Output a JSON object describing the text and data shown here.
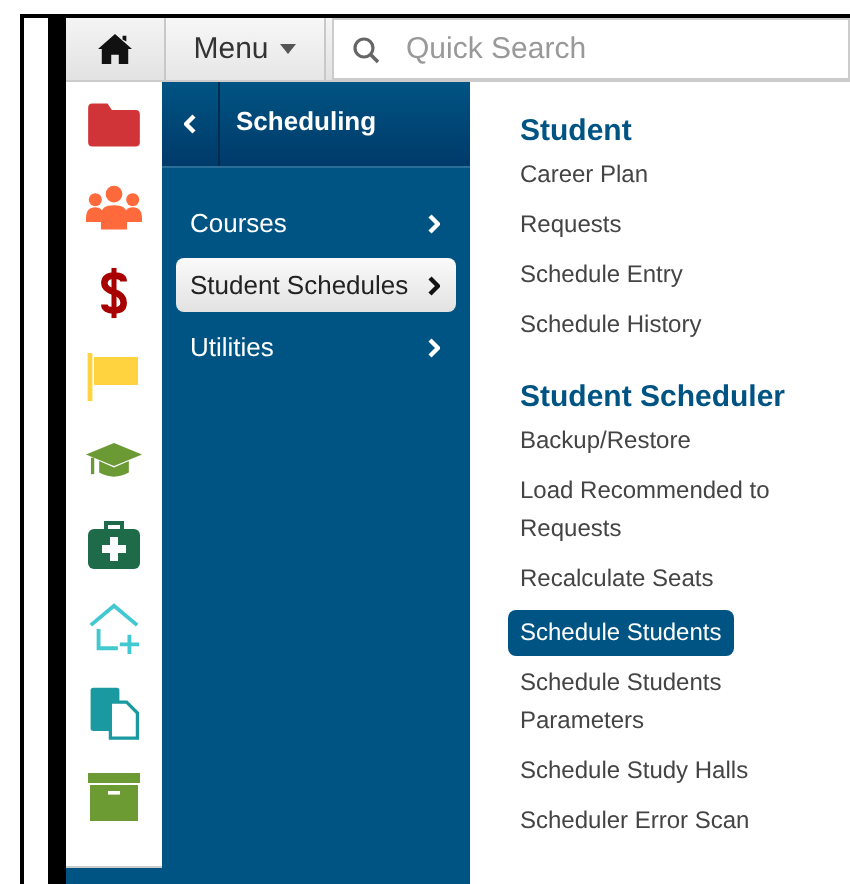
{
  "toolbar": {
    "menu_label": "Menu",
    "search": {
      "placeholder": "Quick Search"
    }
  },
  "submenu": {
    "title": "Scheduling",
    "items": [
      {
        "label": "Courses",
        "selected": false
      },
      {
        "label": "Student Schedules",
        "selected": true
      },
      {
        "label": "Utilities",
        "selected": false
      }
    ]
  },
  "sections": [
    {
      "heading": "Student",
      "items": [
        {
          "label": "Career Plan",
          "selected": false
        },
        {
          "label": "Requests",
          "selected": false
        },
        {
          "label": "Schedule Entry",
          "selected": false
        },
        {
          "label": "Schedule History",
          "selected": false
        }
      ]
    },
    {
      "heading": "Student Scheduler",
      "items": [
        {
          "label": "Backup/Restore",
          "selected": false
        },
        {
          "label": "Load Recommended to Requests",
          "selected": false
        },
        {
          "label": "Recalculate Seats",
          "selected": false
        },
        {
          "label": "Schedule Students",
          "selected": true
        },
        {
          "label": "Schedule Students Parameters",
          "selected": false
        },
        {
          "label": "Schedule Study Halls",
          "selected": false
        },
        {
          "label": "Scheduler Error Scan",
          "selected": false
        }
      ]
    }
  ]
}
